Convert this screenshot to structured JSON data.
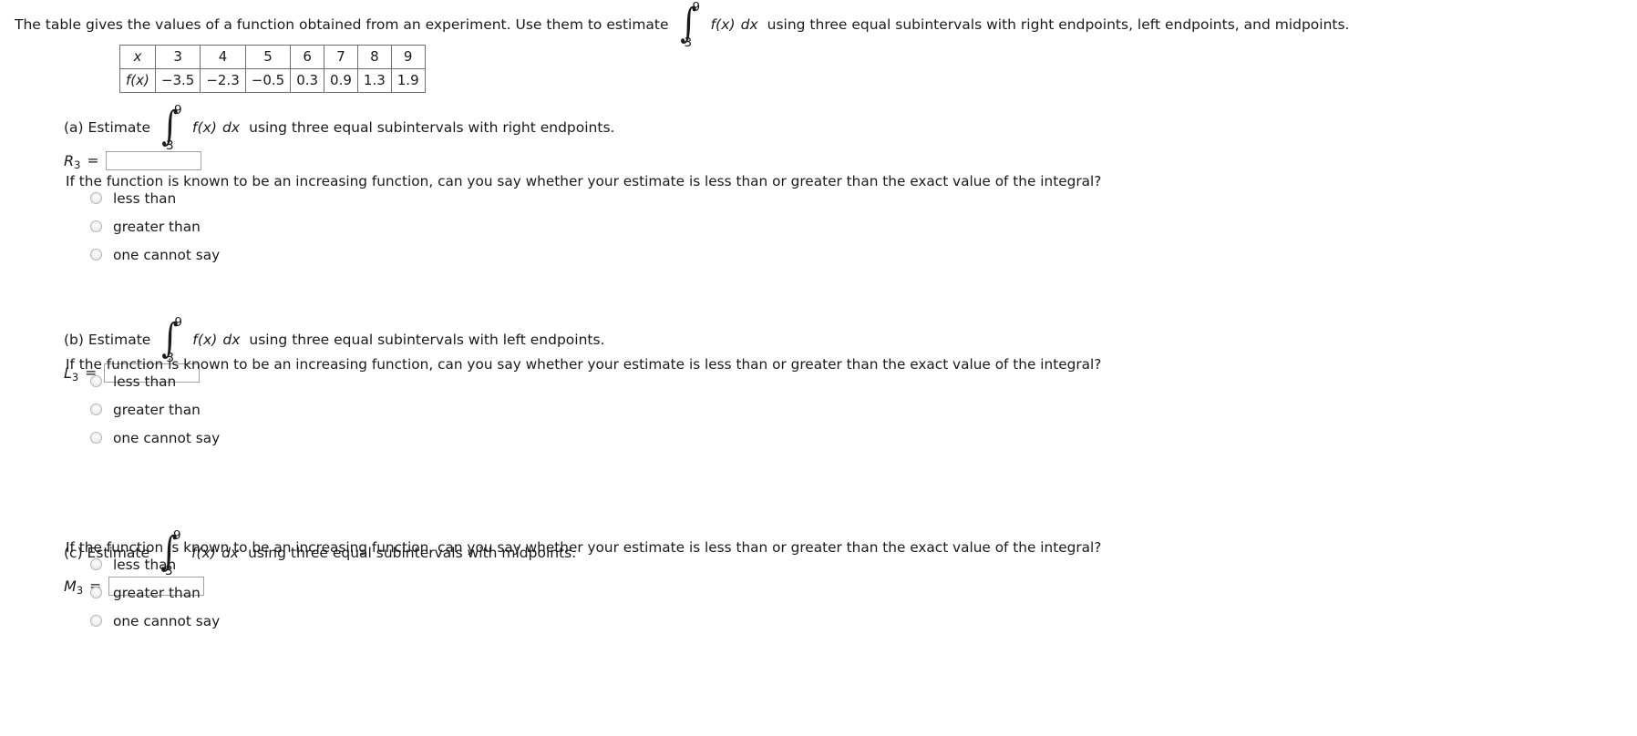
{
  "prompt": {
    "before": "The table gives the values of a function obtained from an experiment. Use them to estimate",
    "integral_lower": "3",
    "integral_upper": "9",
    "integrand": "f(x)",
    "differential": "dx",
    "after": "using three equal subintervals with right endpoints, left endpoints, and midpoints."
  },
  "table": {
    "row_labels": [
      "x",
      "f(x)"
    ],
    "x": [
      "3",
      "4",
      "5",
      "6",
      "7",
      "8",
      "9"
    ],
    "fx": [
      "−3.5",
      "−2.3",
      "−0.5",
      "0.3",
      "0.9",
      "1.3",
      "1.9"
    ]
  },
  "parts": [
    {
      "label": "(a) Estimate",
      "integral_lower": "3",
      "integral_upper": "9",
      "integrand": "f(x)",
      "differential": "dx",
      "after": "using three equal subintervals with right endpoints.",
      "var_name": "R",
      "var_sub": "3",
      "equals": "=",
      "value": "",
      "placeholder": "",
      "question": "If the function is known to be an increasing function, can you say whether your estimate is less than or greater than the exact value of the integral?",
      "options": [
        "less than",
        "greater than",
        "one cannot say"
      ],
      "selected": null
    },
    {
      "label": "(b) Estimate",
      "integral_lower": "3",
      "integral_upper": "9",
      "integrand": "f(x)",
      "differential": "dx",
      "after": "using three equal subintervals with left endpoints.",
      "var_name": "L",
      "var_sub": "3",
      "equals": "=",
      "value": "",
      "placeholder": "",
      "question": "If the function is known to be an increasing function, can you say whether your estimate is less than or greater than the exact value of the integral?",
      "options": [
        "less than",
        "greater than",
        "one cannot say"
      ],
      "selected": null
    },
    {
      "label": "(c) Estimate",
      "integral_lower": "3",
      "integral_upper": "9",
      "integrand": "f(x)",
      "differential": "dx",
      "after": "using three equal subintervals with midpoints.",
      "var_name": "M",
      "var_sub": "3",
      "equals": "=",
      "value": "",
      "placeholder": "",
      "question": "If the function is known to be an increasing function, can you say whether your estimate is less than or greater than the exact value of the integral?",
      "options": [
        "less than",
        "greater than",
        "one cannot say"
      ],
      "selected": null
    }
  ],
  "colors": {
    "text": "#1a1a1a",
    "table_border": "#6f6f6f",
    "input_border": "#a0a0a0",
    "radio_border": "#b4b4b4",
    "background": "#ffffff"
  }
}
